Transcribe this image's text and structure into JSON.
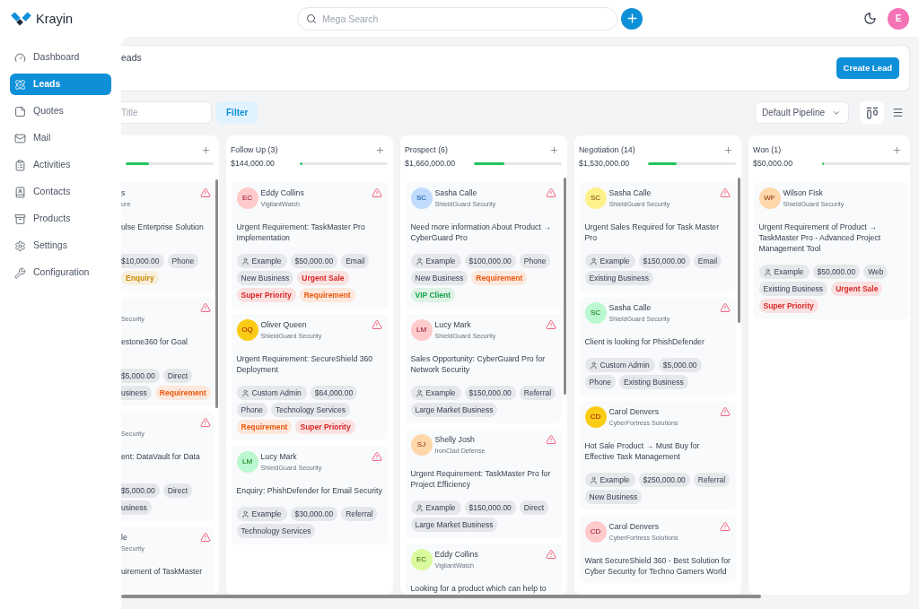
{
  "header": {
    "logo": "Krayin",
    "search": {
      "placeholder": "Mega Search"
    },
    "avatar": "E"
  },
  "sidebar": {
    "items": [
      {
        "label": "Dashboard",
        "selected": false
      },
      {
        "label": "Leads",
        "selected": true
      },
      {
        "label": "Quotes",
        "selected": false
      },
      {
        "label": "Mail",
        "selected": false
      },
      {
        "label": "Activities",
        "selected": false
      },
      {
        "label": "Contacts",
        "selected": false
      },
      {
        "label": "Products",
        "selected": false
      },
      {
        "label": "Settings",
        "selected": false
      },
      {
        "label": "Configuration",
        "selected": false
      }
    ]
  },
  "page": {
    "title": "eads",
    "create_button": "Create Lead"
  },
  "toolbar": {
    "search": {
      "placeholder": "Title"
    },
    "filter_button": "Filter",
    "pipeline": "Default Pipeline"
  },
  "columns": [
    {
      "level": 0.27,
      "cards": [
        {
          "name": "s",
          "company": "ure",
          "warning": true,
          "title": "ulse Enterprise Solution",
          "tags": [
            {
              "kind": "cut",
              "text": "$10,000.00"
            },
            {
              "kind": "plain",
              "text": "Phone"
            },
            {
              "kind": "label",
              "text": "Enquiry",
              "color": "#ca8a04"
            }
          ]
        },
        {
          "company": "Security",
          "warning": true,
          "title": "estone360 for Goal",
          "tags": [
            {
              "kind": "cut",
              "text": "$5,000.00"
            },
            {
              "kind": "plain",
              "text": "Direct"
            },
            {
              "kind": "cut",
              "text": "usiness"
            },
            {
              "kind": "label",
              "text": "Requirement",
              "color": "#ea580c"
            }
          ]
        },
        {
          "company": "Security",
          "warning": true,
          "title": "ent: DataVault for Data",
          "tags": [
            {
              "kind": "cut",
              "text": "$5,000.00"
            },
            {
              "kind": "plain",
              "text": "Direct"
            },
            {
              "kind": "cut",
              "text": "usiness"
            }
          ]
        },
        {
          "name": "le",
          "company": "Security",
          "warning": true,
          "title": "uirement of TaskMaster"
        }
      ]
    },
    {
      "title": "Follow Up (3)",
      "amount": "$144,000.00",
      "level": 0.03,
      "cards": [
        {
          "initials": "EC",
          "color": "#fecaca",
          "name": "Eddy Collins",
          "company": "VigilantWatch",
          "warning": true,
          "title": "Urgent Requirement: TaskMaster Pro Implementation",
          "tags": [
            {
              "kind": "user",
              "text": "Example"
            },
            {
              "kind": "plain",
              "text": "$50,000.00"
            },
            {
              "kind": "plain",
              "text": "Email"
            },
            {
              "kind": "plain",
              "text": "New Business"
            },
            {
              "kind": "label",
              "text": "Urgent Sale",
              "color": "#dc2626"
            },
            {
              "kind": "label",
              "text": "Super Priority",
              "color": "#dc2626"
            },
            {
              "kind": "label",
              "text": "Requirement",
              "color": "#ea580c"
            }
          ]
        },
        {
          "initials": "OQ",
          "color": "#facc15",
          "name": "Oliver Queen",
          "company": "ShieldGuard Security",
          "warning": true,
          "title": "Urgent Requirement: SecureShield 360 Deployment",
          "tags": [
            {
              "kind": "user",
              "text": "Custom Admin"
            },
            {
              "kind": "plain",
              "text": "$64,000.00"
            },
            {
              "kind": "plain",
              "text": "Phone"
            },
            {
              "kind": "plain",
              "text": "Technology Services"
            },
            {
              "kind": "label",
              "text": "Requirement",
              "color": "#ea580c"
            },
            {
              "kind": "label",
              "text": "Super Priority",
              "color": "#dc2626"
            }
          ]
        },
        {
          "initials": "LM",
          "color": "#bbf7d0",
          "name": "Lucy Mark",
          "company": "ShieldGuard Security",
          "warning": true,
          "title": "Enquiry: PhishDefender for Email Security",
          "tags": [
            {
              "kind": "user",
              "text": "Example"
            },
            {
              "kind": "plain",
              "text": "$30,000.00"
            },
            {
              "kind": "plain",
              "text": "Referral"
            },
            {
              "kind": "plain",
              "text": "Technology Services"
            }
          ]
        }
      ]
    },
    {
      "title": "Prospect (6)",
      "amount": "$1,660,000.00",
      "level": 0.35,
      "cards": [
        {
          "initials": "SC",
          "color": "#bfdbfe",
          "name": "Sasha Calle",
          "company": "ShieldGuard Security",
          "warning": true,
          "title": "Need more information About Product → CyberGuard Pro",
          "tags": [
            {
              "kind": "user",
              "text": "Example"
            },
            {
              "kind": "plain",
              "text": "$100,000.00"
            },
            {
              "kind": "plain",
              "text": "Phone"
            },
            {
              "kind": "plain",
              "text": "New Business"
            },
            {
              "kind": "label",
              "text": "Requirement",
              "color": "#ea580c"
            },
            {
              "kind": "label",
              "text": "VIP Client",
              "color": "#16a34a"
            }
          ]
        },
        {
          "initials": "LM",
          "color": "#fecaca",
          "name": "Lucy Mark",
          "company": "ShieldGuard Security",
          "warning": true,
          "title": "Sales Opportunity: CyberGuard Pro for Network Security",
          "tags": [
            {
              "kind": "user",
              "text": "Example"
            },
            {
              "kind": "plain",
              "text": "$150,000.00"
            },
            {
              "kind": "plain",
              "text": "Referral"
            },
            {
              "kind": "plain",
              "text": "Large Market Business"
            }
          ]
        },
        {
          "initials": "SJ",
          "color": "#fed7aa",
          "name": "Shelly Josh",
          "company": "IronClad Defense",
          "warning": true,
          "title": "Urgent Requirement: TaskMaster Pro for Project Efficiency",
          "tags": [
            {
              "kind": "user",
              "text": "Example"
            },
            {
              "kind": "plain",
              "text": "$150,000.00"
            },
            {
              "kind": "plain",
              "text": "Direct"
            },
            {
              "kind": "plain",
              "text": "Large Market Business"
            }
          ]
        },
        {
          "initials": "EC",
          "color": "#d9f99d",
          "name": "Eddy Collins",
          "company": "VigilantWatch",
          "warning": true,
          "title": "Looking for a product which can help to"
        }
      ]
    },
    {
      "title": "Negotiation (14)",
      "amount": "$1,530,000.00",
      "level": 0.33,
      "cards": [
        {
          "initials": "SC",
          "color": "#fef08a",
          "name": "Sasha Calle",
          "company": "ShieldGuard Security",
          "warning": true,
          "title": "Urgent Sales Required for Task Master Pro",
          "tags": [
            {
              "kind": "user",
              "text": "Example"
            },
            {
              "kind": "plain",
              "text": "$150,000.00"
            },
            {
              "kind": "plain",
              "text": "Email"
            },
            {
              "kind": "plain",
              "text": "Existing Business"
            }
          ]
        },
        {
          "initials": "SC",
          "color": "#bbf7d0",
          "name": "Sasha Calle",
          "company": "ShieldGuard Security",
          "warning": true,
          "title": "Client is looking for PhishDefender",
          "tags": [
            {
              "kind": "user",
              "text": "Custom Admin"
            },
            {
              "kind": "plain",
              "text": "$5,000.00"
            },
            {
              "kind": "plain",
              "text": "Phone"
            },
            {
              "kind": "plain",
              "text": "Existing Business"
            }
          ]
        },
        {
          "initials": "CD",
          "color": "#facc15",
          "name": "Carol Denvers",
          "company": "CyberFortress Solutions",
          "warning": true,
          "title": "Hot Sale Product → Must Buy for Effective Task Management",
          "tags": [
            {
              "kind": "user",
              "text": "Example"
            },
            {
              "kind": "plain",
              "text": "$250,000.00"
            },
            {
              "kind": "plain",
              "text": "Referral"
            },
            {
              "kind": "plain",
              "text": "New Business"
            }
          ]
        },
        {
          "initials": "CD",
          "color": "#fecaca",
          "name": "Carol Denvers",
          "company": "CyberFortress Solutions",
          "warning": true,
          "title": "Want SecureShield 360 - Best Solution for Cyber Security for Techno Gamers World"
        }
      ]
    },
    {
      "title": "Won (1)",
      "amount": "$50,000.00",
      "level": 0.02,
      "cards": [
        {
          "initials": "WF",
          "color": "#fed7aa",
          "name": "Wilson Fisk",
          "company": "ShieldGuard Security",
          "warning": false,
          "title": "Urgent Requirement of Product → TaskMaster Pro - Advanced Project Management Tool",
          "tags": [
            {
              "kind": "user",
              "text": "Example"
            },
            {
              "kind": "plain",
              "text": "$50,000.00"
            },
            {
              "kind": "plain",
              "text": "Web"
            },
            {
              "kind": "plain",
              "text": "Existing Business"
            },
            {
              "kind": "label",
              "text": "Urgent Sale",
              "color": "#dc2626"
            },
            {
              "kind": "label",
              "text": "Super Priority",
              "color": "#dc2626"
            }
          ]
        }
      ]
    }
  ]
}
